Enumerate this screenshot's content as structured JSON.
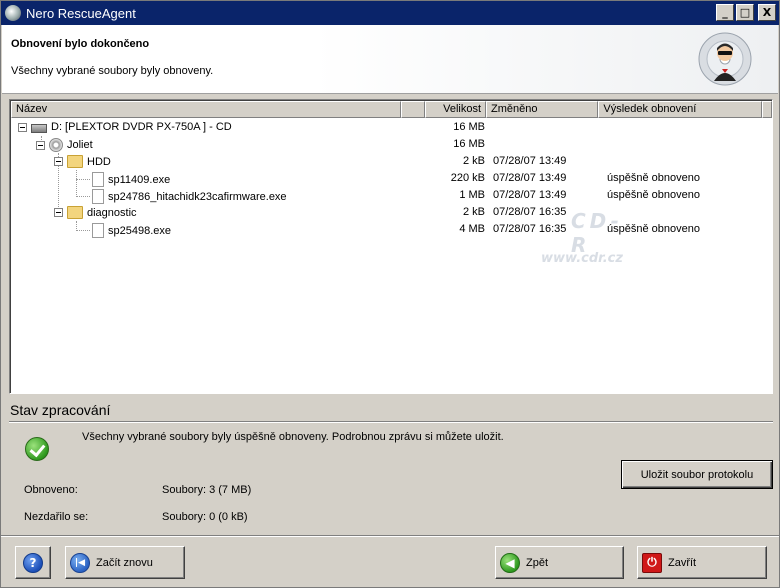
{
  "window": {
    "title": "Nero RescueAgent",
    "controls": {
      "minimize": "_",
      "maximize": "□",
      "close": "X"
    }
  },
  "header": {
    "title": "Obnovení bylo dokončeno",
    "subtitle": "Všechny vybrané soubory byly obnoveny."
  },
  "list": {
    "columns": [
      "Název",
      "",
      "Velikost",
      "Změněno",
      "Výsledek obnovení"
    ],
    "rows": [
      {
        "level": 0,
        "icon": "drive-icon",
        "name": "D: [PLEXTOR  DVDR   PX-750A  ] - CD",
        "size": "16 MB",
        "modified": "",
        "result": "",
        "expander": true
      },
      {
        "level": 1,
        "icon": "disc-icon",
        "name": "Joliet",
        "size": "16 MB",
        "modified": "",
        "result": "",
        "expander": true
      },
      {
        "level": 2,
        "icon": "folder-icon",
        "name": "HDD",
        "size": "2 kB",
        "modified": "07/28/07 13:49",
        "result": "",
        "expander": true
      },
      {
        "level": 3,
        "icon": "file-icon",
        "name": "sp11409.exe",
        "size": "220 kB",
        "modified": "07/28/07 13:49",
        "result": "úspěšně obnoveno",
        "expander": false
      },
      {
        "level": 3,
        "icon": "file-icon",
        "name": "sp24786_hitachidk23cafirmware.exe",
        "size": "1 MB",
        "modified": "07/28/07 13:49",
        "result": "úspěšně obnoveno",
        "expander": false
      },
      {
        "level": 2,
        "icon": "folder-icon",
        "name": "diagnostic",
        "size": "2 kB",
        "modified": "07/28/07 16:35",
        "result": "",
        "expander": true
      },
      {
        "level": 3,
        "icon": "file-icon",
        "name": "sp25498.exe",
        "size": "4 MB",
        "modified": "07/28/07 16:35",
        "result": "úspěšně obnoveno",
        "expander": false
      }
    ],
    "watermark": {
      "big": "CD-R",
      "url": "www.cdr.cz"
    }
  },
  "status": {
    "title": "Stav zpracování",
    "message": "Všechny vybrané soubory byly úspěšně obnoveny. Podrobnou zprávu si můžete uložit.",
    "save_button": "Uložit soubor protokolu",
    "recovered_label": "Obnoveno:",
    "recovered_value": "Soubory: 3 (7 MB)",
    "failed_label": "Nezdařilo se:",
    "failed_value": "Soubory: 0 (0 kB)"
  },
  "footer": {
    "help_label": "?",
    "restart_label": "Začít znovu",
    "back_label": "Zpět",
    "close_label": "Zavřít"
  }
}
